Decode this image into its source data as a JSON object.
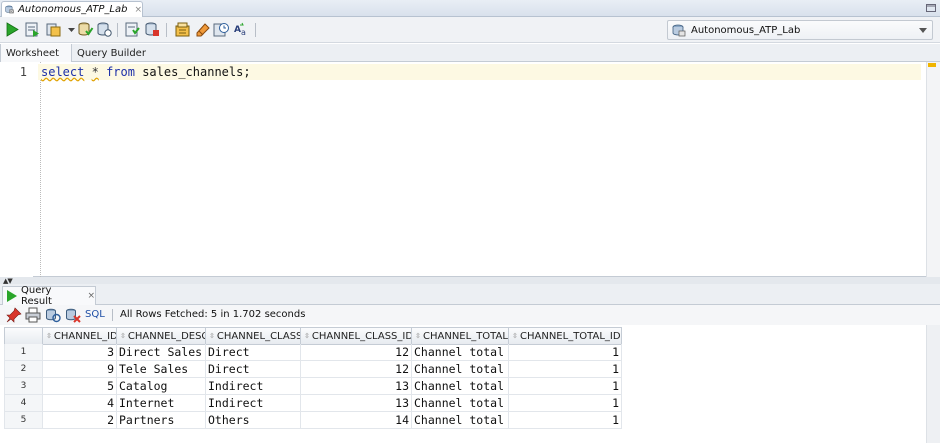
{
  "document_tab": {
    "title": "Autonomous_ATP_Lab",
    "close": "×"
  },
  "toolbar": {
    "buttons": [
      "run-statement",
      "run-script",
      "autotrace",
      "dropdown",
      "commit",
      "rollback",
      "unshared-sql",
      "explain-plan",
      "clear",
      "sql-tuning-advisor",
      "format",
      "find-replace"
    ],
    "connection": "Autonomous_ATP_Lab"
  },
  "subtabs": [
    "Worksheet",
    "Query Builder"
  ],
  "editor": {
    "line_number": "1",
    "tokens": {
      "select": "select",
      "star": "*",
      "from": "from",
      "table": "sales_channels;"
    }
  },
  "results": {
    "tab_label": "Query Result",
    "tab_close": "×",
    "sql_link": "SQL",
    "status": "All Rows Fetched: 5 in 1.702 seconds",
    "columns": [
      "CHANNEL_ID",
      "CHANNEL_DESC",
      "CHANNEL_CLASS",
      "CHANNEL_CLASS_ID",
      "CHANNEL_TOTAL",
      "CHANNEL_TOTAL_ID"
    ],
    "rows": [
      {
        "n": "1",
        "CHANNEL_ID": "3",
        "CHANNEL_DESC": "Direct Sales",
        "CHANNEL_CLASS": "Direct",
        "CHANNEL_CLASS_ID": "12",
        "CHANNEL_TOTAL": "Channel total",
        "CHANNEL_TOTAL_ID": "1"
      },
      {
        "n": "2",
        "CHANNEL_ID": "9",
        "CHANNEL_DESC": "Tele Sales",
        "CHANNEL_CLASS": "Direct",
        "CHANNEL_CLASS_ID": "12",
        "CHANNEL_TOTAL": "Channel total",
        "CHANNEL_TOTAL_ID": "1"
      },
      {
        "n": "3",
        "CHANNEL_ID": "5",
        "CHANNEL_DESC": "Catalog",
        "CHANNEL_CLASS": "Indirect",
        "CHANNEL_CLASS_ID": "13",
        "CHANNEL_TOTAL": "Channel total",
        "CHANNEL_TOTAL_ID": "1"
      },
      {
        "n": "4",
        "CHANNEL_ID": "4",
        "CHANNEL_DESC": "Internet",
        "CHANNEL_CLASS": "Indirect",
        "CHANNEL_CLASS_ID": "13",
        "CHANNEL_TOTAL": "Channel total",
        "CHANNEL_TOTAL_ID": "1"
      },
      {
        "n": "5",
        "CHANNEL_ID": "2",
        "CHANNEL_DESC": "Partners",
        "CHANNEL_CLASS": "Others",
        "CHANNEL_CLASS_ID": "14",
        "CHANNEL_TOTAL": "Channel total",
        "CHANNEL_TOTAL_ID": "1"
      }
    ]
  },
  "colors": {
    "keyword": "#1c2fa8",
    "current_line": "#fdf9e3",
    "run_green": "#2aa52a",
    "link": "#1f4fa6"
  }
}
